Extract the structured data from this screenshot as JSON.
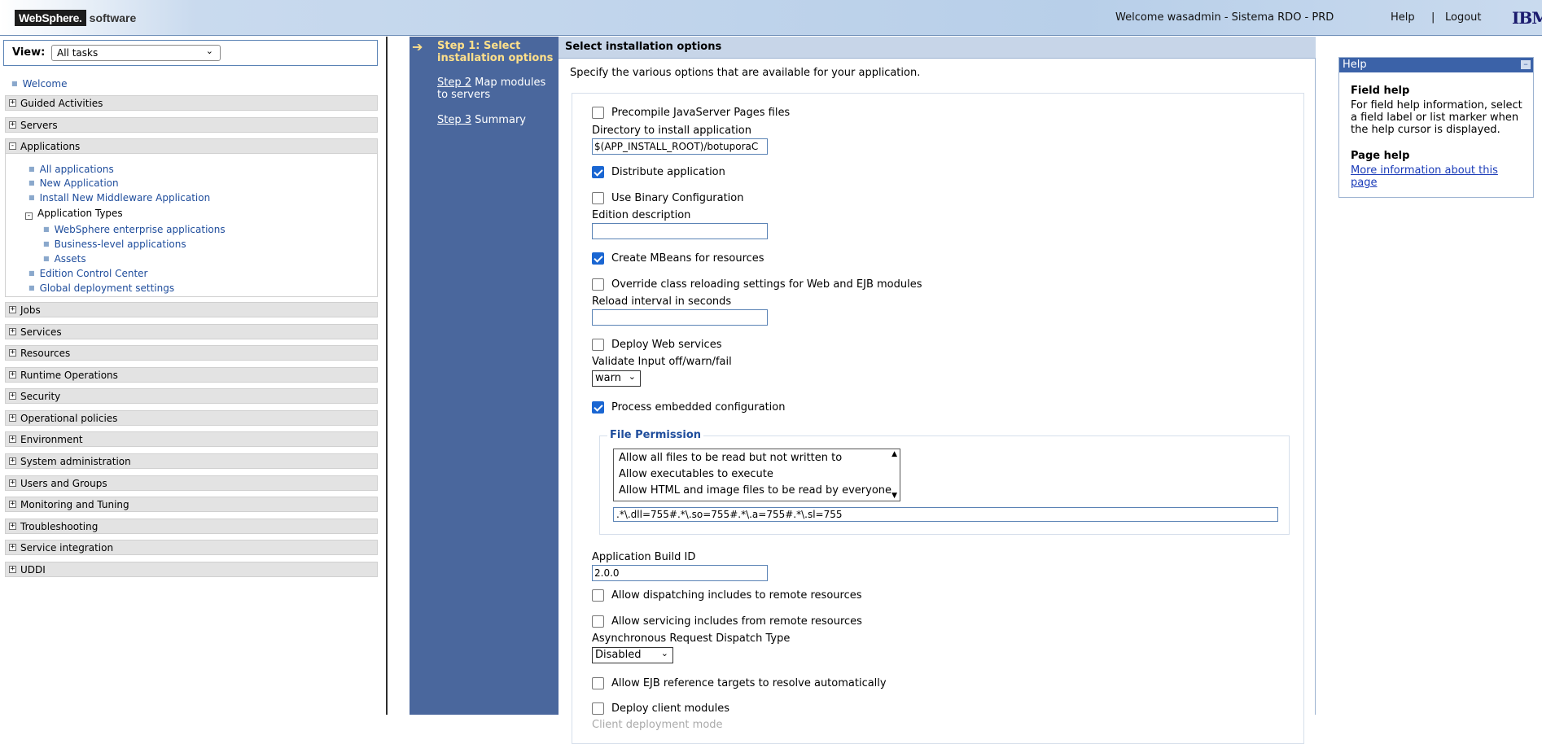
{
  "banner": {
    "logo_brand": "WebSphere.",
    "logo_suffix": "software",
    "welcome": "Welcome wasadmin - Sistema RDO - PRD",
    "help_label": "Help",
    "separator": "|",
    "logout_label": "Logout",
    "vendor_logo": "IBM"
  },
  "nav": {
    "view_label": "View:",
    "view_value": "All tasks",
    "welcome_link": "Welcome",
    "categories": [
      {
        "label": "Guided Activities",
        "state": "+"
      },
      {
        "label": "Servers",
        "state": "+"
      },
      {
        "label": "Applications",
        "state": "-"
      },
      {
        "label": "Jobs",
        "state": "+"
      },
      {
        "label": "Services",
        "state": "+"
      },
      {
        "label": "Resources",
        "state": "+"
      },
      {
        "label": "Runtime Operations",
        "state": "+"
      },
      {
        "label": "Security",
        "state": "+"
      },
      {
        "label": "Operational policies",
        "state": "+"
      },
      {
        "label": "Environment",
        "state": "+"
      },
      {
        "label": "System administration",
        "state": "+"
      },
      {
        "label": "Users and Groups",
        "state": "+"
      },
      {
        "label": "Monitoring and Tuning",
        "state": "+"
      },
      {
        "label": "Troubleshooting",
        "state": "+"
      },
      {
        "label": "Service integration",
        "state": "+"
      },
      {
        "label": "UDDI",
        "state": "+"
      }
    ],
    "applications": {
      "links": [
        "All applications",
        "New Application",
        "Install New Middleware Application"
      ],
      "app_types_label": "Application Types",
      "app_types_state": "-",
      "app_types": [
        "WebSphere enterprise applications",
        "Business-level applications",
        "Assets"
      ],
      "more_links": [
        "Edition Control Center",
        "Global deployment settings"
      ]
    }
  },
  "wizard": {
    "steps": [
      {
        "num": "Step 1:",
        "label": "Select installation options",
        "current": true
      },
      {
        "num": "Step 2",
        "label": "Map modules to servers",
        "current": false
      },
      {
        "num": "Step 3",
        "label": "Summary",
        "current": false
      }
    ],
    "arrow_icon": "arrow-right-icon"
  },
  "content": {
    "title": "Select installation options",
    "description": "Specify the various options that are available for your application.",
    "options": {
      "precompile_jsp": {
        "label": "Precompile JavaServer Pages files",
        "checked": false
      },
      "install_dir": {
        "label": "Directory to install application",
        "value": "$(APP_INSTALL_ROOT)/botuporaC"
      },
      "distribute_app": {
        "label": "Distribute application",
        "checked": true
      },
      "binary_config": {
        "label": "Use Binary Configuration",
        "checked": false
      },
      "edition_desc": {
        "label": "Edition description",
        "value": ""
      },
      "create_mbeans": {
        "label": "Create MBeans for resources",
        "checked": true
      },
      "override_reload": {
        "label": "Override class reloading settings for Web and EJB modules",
        "checked": false
      },
      "reload_interval": {
        "label": "Reload interval in seconds",
        "value": ""
      },
      "deploy_ws": {
        "label": "Deploy Web services",
        "checked": false
      },
      "validate_input": {
        "label": "Validate Input off/warn/fail",
        "value": "warn"
      },
      "process_embedded": {
        "label": "Process embedded configuration",
        "checked": true
      },
      "file_permission": {
        "legend": "File Permission",
        "items": [
          "Allow all files to be read but not written to",
          "Allow executables to execute",
          "Allow HTML and image files to be read by everyone"
        ],
        "value": ".*\\.dll=755#.*\\.so=755#.*\\.a=755#.*\\.sl=755"
      },
      "build_id": {
        "label": "Application Build ID",
        "value": "2.0.0"
      },
      "dispatch_remote": {
        "label": "Allow dispatching includes to remote resources",
        "checked": false
      },
      "service_remote": {
        "label": "Allow servicing includes from remote resources",
        "checked": false
      },
      "async_dispatch": {
        "label": "Asynchronous Request Dispatch Type",
        "value": "Disabled"
      },
      "ejb_targets": {
        "label": "Allow EJB reference targets to resolve automatically",
        "checked": false
      },
      "deploy_client": {
        "label": "Deploy client modules",
        "checked": false
      },
      "client_mode": {
        "label": "Client deployment mode"
      }
    }
  },
  "help": {
    "title": "Help",
    "minimize": "–",
    "field_help_heading": "Field help",
    "field_help_text": "For field help information, select a field label or list marker when the help cursor is displayed.",
    "page_help_heading": "Page help",
    "page_help_link": "More information about this page"
  },
  "colors": {
    "steps_bg": "#4a679d",
    "content_header_bg": "#c7d5e8",
    "link": "#1f4d9c",
    "checkbox_checked": "#1a66d2"
  }
}
